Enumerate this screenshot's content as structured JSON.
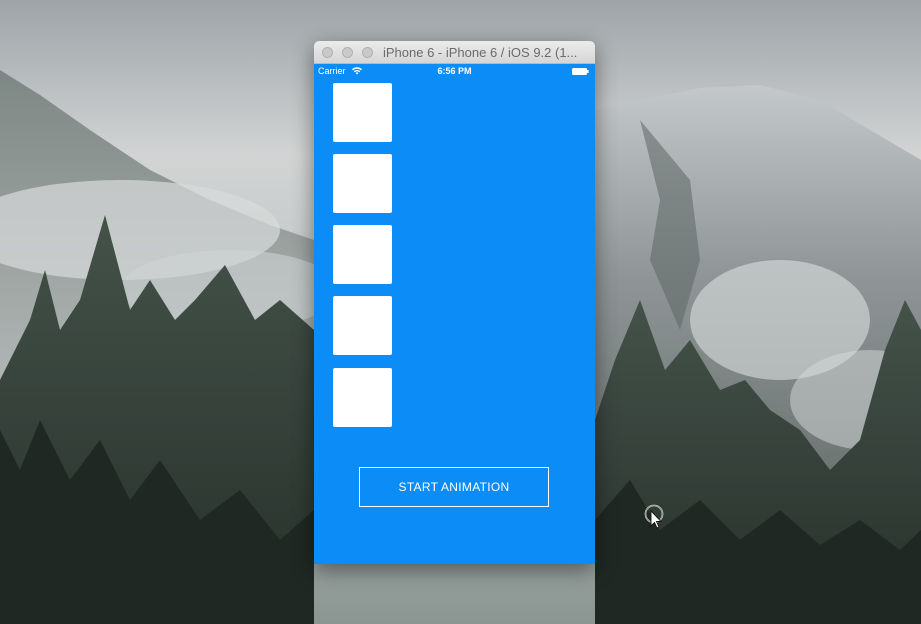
{
  "desktop": {
    "wallpaper": "mountain-forest-wallpaper"
  },
  "window": {
    "title": "iPhone 6 - iPhone 6 / iOS 9.2 (1..."
  },
  "statusbar": {
    "carrier": "Carrier",
    "time": "6:56 PM",
    "wifi_icon": "wifi-icon",
    "battery_icon": "battery-icon"
  },
  "app": {
    "background_color": "#0b8cf7",
    "square_color": "#ffffff",
    "square_count": 5,
    "start_button_label": "START ANIMATION"
  },
  "cursor": {
    "icon": "pointer-cursor-icon"
  }
}
